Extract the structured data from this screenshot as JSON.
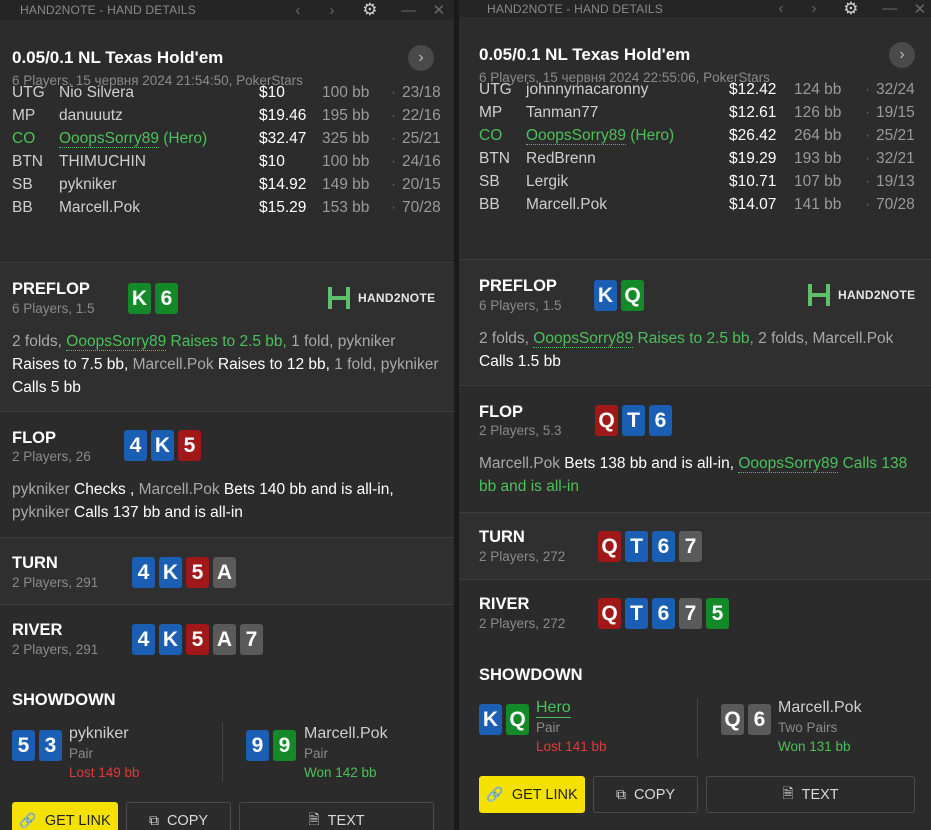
{
  "panels": [
    {
      "app_title": "HAND2NOTE - HAND DETAILS",
      "game": "0.05/0.1 NL Texas Hold'em",
      "meta": "6 Players, 15 червня 2024 21:54:50, PokerStars",
      "players": [
        {
          "pos": "UTG",
          "name": "Nio Silvera",
          "stack": "$10",
          "bb": "100 bb",
          "stat": "23/18",
          "hero": false
        },
        {
          "pos": "MP",
          "name": "danuuutz",
          "stack": "$19.46",
          "bb": "195 bb",
          "stat": "22/16",
          "hero": false
        },
        {
          "pos": "CO",
          "name": "OoopsSorry89",
          "hero_tag": " (Hero)",
          "stack": "$32.47",
          "bb": "325 bb",
          "stat": "25/21",
          "hero": true
        },
        {
          "pos": "BTN",
          "name": "THIMUCHIN",
          "stack": "$10",
          "bb": "100 bb",
          "stat": "24/16",
          "hero": false
        },
        {
          "pos": "SB",
          "name": "pykniker",
          "stack": "$14.92",
          "bb": "149 bb",
          "stat": "20/15",
          "hero": false
        },
        {
          "pos": "BB",
          "name": "Marcell.Pok",
          "stack": "$15.29",
          "bb": "153 bb",
          "stat": "70/28",
          "hero": false
        }
      ],
      "logo_text": "HAND2NOTE",
      "streets": {
        "preflop": {
          "name": "PREFLOP",
          "sub": "6 Players, 1.5",
          "cards": [
            {
              "r": "K",
              "s": "c"
            },
            {
              "r": "6",
              "s": "c"
            }
          ],
          "action": [
            {
              "t": "2 folds, ",
              "c": "gray"
            },
            {
              "t": "OoopsSorry89",
              "c": "green-u"
            },
            {
              "t": " Raises to 2.5 bb, ",
              "c": "green"
            },
            {
              "t": "1 fold, pykniker",
              "c": "gray"
            },
            {
              "t": " Raises to 7.5 bb, ",
              "c": "white"
            },
            {
              "t": "Marcell.Pok",
              "c": "gray"
            },
            {
              "t": " Raises to 12 bb, ",
              "c": "white"
            },
            {
              "t": "1 fold,",
              "c": "gray"
            },
            {
              "t": " pykniker",
              "c": "gray"
            },
            {
              "t": " Calls 5 bb",
              "c": "white"
            }
          ]
        },
        "flop": {
          "name": "FLOP",
          "sub": "2 Players, 26",
          "cards": [
            {
              "r": "4",
              "s": "d"
            },
            {
              "r": "K",
              "s": "d"
            },
            {
              "r": "5",
              "s": "h"
            }
          ],
          "action": [
            {
              "t": "pykniker",
              "c": "gray"
            },
            {
              "t": " Checks , ",
              "c": "white"
            },
            {
              "t": "Marcell.Pok",
              "c": "gray"
            },
            {
              "t": " Bets 140 bb and is all-in,",
              "c": "white"
            },
            {
              "t": " pykniker",
              "c": "gray"
            },
            {
              "t": " Calls 137 bb and is all-in",
              "c": "white"
            }
          ]
        },
        "turn": {
          "name": "TURN",
          "sub": "2 Players, 291",
          "cards": [
            {
              "r": "4",
              "s": "d"
            },
            {
              "r": "K",
              "s": "d"
            },
            {
              "r": "5",
              "s": "h"
            },
            {
              "r": "A",
              "s": "s"
            }
          ]
        },
        "river": {
          "name": "RIVER",
          "sub": "2 Players, 291",
          "cards": [
            {
              "r": "4",
              "s": "d"
            },
            {
              "r": "K",
              "s": "d"
            },
            {
              "r": "5",
              "s": "h"
            },
            {
              "r": "A",
              "s": "s"
            },
            {
              "r": "7",
              "s": "s"
            }
          ]
        }
      },
      "showdown": {
        "title": "SHOWDOWN",
        "players": [
          {
            "name": "pykniker",
            "hand": "Pair",
            "result": "Lost 149 bb",
            "won": false,
            "hero": false,
            "cards": [
              {
                "r": "5",
                "s": "d"
              },
              {
                "r": "3",
                "s": "d"
              }
            ]
          },
          {
            "name": "Marcell.Pok",
            "hand": "Pair",
            "result": "Won 142 bb",
            "won": true,
            "hero": false,
            "cards": [
              {
                "r": "9",
                "s": "d"
              },
              {
                "r": "9",
                "s": "c"
              }
            ]
          }
        ]
      },
      "buttons": {
        "link": "GET LINK",
        "copy": "COPY",
        "text": "TEXT"
      }
    },
    {
      "app_title": "HAND2NOTE - HAND DETAILS",
      "game": "0.05/0.1 NL Texas Hold'em",
      "meta": "6 Players, 15 червня 2024 22:55:06, PokerStars",
      "players": [
        {
          "pos": "UTG",
          "name": "johnnymacaronny",
          "stack": "$12.42",
          "bb": "124 bb",
          "stat": "32/24",
          "hero": false
        },
        {
          "pos": "MP",
          "name": "Tanman77",
          "stack": "$12.61",
          "bb": "126 bb",
          "stat": "19/15",
          "hero": false
        },
        {
          "pos": "CO",
          "name": "OoopsSorry89",
          "hero_tag": " (Hero)",
          "stack": "$26.42",
          "bb": "264 bb",
          "stat": "25/21",
          "hero": true
        },
        {
          "pos": "BTN",
          "name": "RedBrenn",
          "stack": "$19.29",
          "bb": "193 bb",
          "stat": "32/21",
          "hero": false
        },
        {
          "pos": "SB",
          "name": "Lergik",
          "stack": "$10.71",
          "bb": "107 bb",
          "stat": "19/13",
          "hero": false
        },
        {
          "pos": "BB",
          "name": "Marcell.Pok",
          "stack": "$14.07",
          "bb": "141 bb",
          "stat": "70/28",
          "hero": false
        }
      ],
      "logo_text": "HAND2NOTE",
      "streets": {
        "preflop": {
          "name": "PREFLOP",
          "sub": "6 Players, 1.5",
          "cards": [
            {
              "r": "K",
              "s": "d"
            },
            {
              "r": "Q",
              "s": "c"
            }
          ],
          "action": [
            {
              "t": "2 folds, ",
              "c": "gray"
            },
            {
              "t": "OoopsSorry89",
              "c": "green-u"
            },
            {
              "t": " Raises to 2.5 bb, ",
              "c": "green"
            },
            {
              "t": "2 folds, Marcell.Pok",
              "c": "gray"
            },
            {
              "t": " Calls 1.5 bb",
              "c": "white"
            }
          ]
        },
        "flop": {
          "name": "FLOP",
          "sub": "2 Players, 5.3",
          "cards": [
            {
              "r": "Q",
              "s": "h"
            },
            {
              "r": "T",
              "s": "d"
            },
            {
              "r": "6",
              "s": "d"
            }
          ],
          "action": [
            {
              "t": "Marcell.Pok",
              "c": "gray"
            },
            {
              "t": " Bets 138 bb and is all-in, ",
              "c": "white"
            },
            {
              "t": "OoopsSorry89",
              "c": "green-u"
            },
            {
              "t": " Calls 138 bb and is all-in",
              "c": "green"
            }
          ]
        },
        "turn": {
          "name": "TURN",
          "sub": "2 Players, 272",
          "cards": [
            {
              "r": "Q",
              "s": "h"
            },
            {
              "r": "T",
              "s": "d"
            },
            {
              "r": "6",
              "s": "d"
            },
            {
              "r": "7",
              "s": "s"
            }
          ]
        },
        "river": {
          "name": "RIVER",
          "sub": "2 Players, 272",
          "cards": [
            {
              "r": "Q",
              "s": "h"
            },
            {
              "r": "T",
              "s": "d"
            },
            {
              "r": "6",
              "s": "d"
            },
            {
              "r": "7",
              "s": "s"
            },
            {
              "r": "5",
              "s": "c"
            }
          ]
        }
      },
      "showdown": {
        "title": "SHOWDOWN",
        "players": [
          {
            "name": "Hero",
            "hand": "Pair",
            "result": "Lost 141 bb",
            "won": false,
            "hero": true,
            "cards": [
              {
                "r": "K",
                "s": "d"
              },
              {
                "r": "Q",
                "s": "c"
              }
            ]
          },
          {
            "name": "Marcell.Pok",
            "hand": "Two Pairs",
            "result": "Won 131 bb",
            "won": true,
            "hero": false,
            "cards": [
              {
                "r": "Q",
                "s": "s"
              },
              {
                "r": "6",
                "s": "s"
              }
            ]
          }
        ]
      },
      "buttons": {
        "link": "GET LINK",
        "copy": "COPY",
        "text": "TEXT"
      }
    }
  ],
  "icons": {
    "prev": "chevron-left-icon",
    "next": "chevron-right-icon",
    "settings": "gear-icon",
    "minimize": "minimize-icon",
    "close": "close-icon",
    "link": "link-icon",
    "copy": "copy-icon",
    "text": "document-icon"
  }
}
